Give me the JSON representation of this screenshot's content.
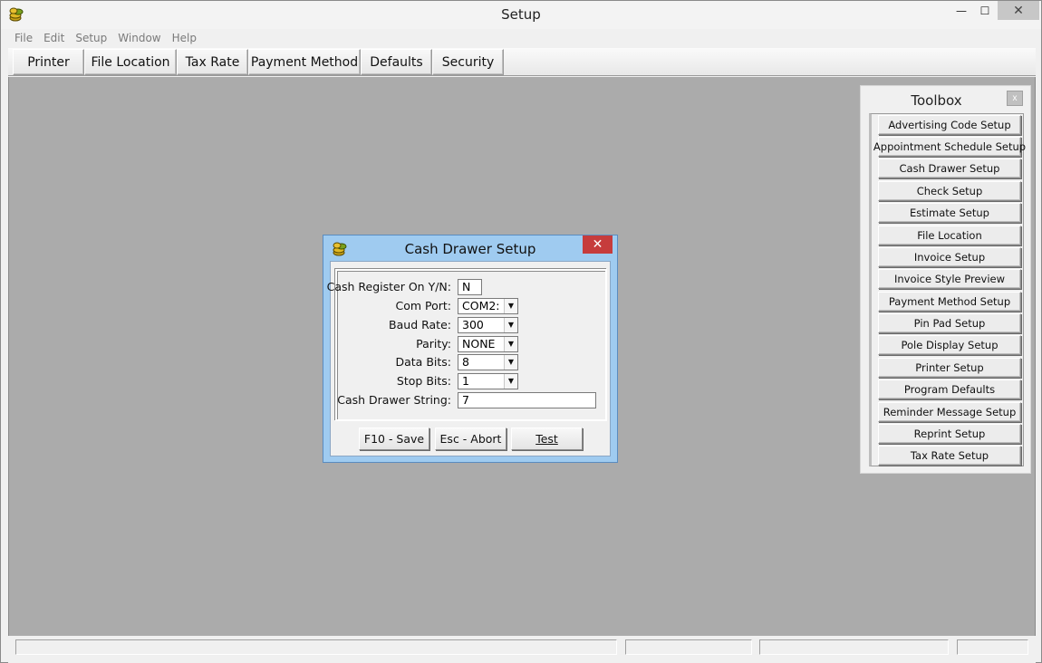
{
  "window": {
    "title": "Setup",
    "minimize_glyph": "—",
    "maximize_glyph": "☐",
    "close_glyph": "✕"
  },
  "menu": [
    "File",
    "Edit",
    "Setup",
    "Window",
    "Help"
  ],
  "toolbar": [
    "Printer",
    "File Location",
    "Tax Rate",
    "Payment Method",
    "Defaults",
    "Security"
  ],
  "toolbox": {
    "title": "Toolbox",
    "close_glyph": "x",
    "items": [
      "Advertising Code Setup",
      "Appointment Schedule Setup",
      "Cash Drawer Setup",
      "Check Setup",
      "Estimate Setup",
      "File Location",
      "Invoice Setup",
      "Invoice Style Preview",
      "Payment Method Setup",
      "Pin Pad Setup",
      "Pole Display Setup",
      "Printer Setup",
      "Program Defaults",
      "Reminder Message Setup",
      "Reprint Setup",
      "Tax Rate Setup"
    ]
  },
  "dialog": {
    "title": "Cash Drawer Setup",
    "close_glyph": "✕",
    "fields": {
      "cash_register_label": "Cash Register On Y/N:",
      "cash_register_value": "N",
      "com_port_label": "Com Port:",
      "com_port_value": "COM2:",
      "baud_rate_label": "Baud Rate:",
      "baud_rate_value": "300",
      "parity_label": "Parity:",
      "parity_value": "NONE",
      "data_bits_label": "Data Bits:",
      "data_bits_value": "8",
      "stop_bits_label": "Stop Bits:",
      "stop_bits_value": "1",
      "drawer_string_label": "Cash Drawer String:",
      "drawer_string_value": "7"
    },
    "buttons": {
      "save": "F10 - Save",
      "abort": "Esc - Abort",
      "test": "Test"
    }
  },
  "colors": {
    "workspace": "#ababab",
    "dialog_frame": "#9fcbf0",
    "dialog_close": "#c63c3c"
  },
  "icons": {
    "app": "coins-icon",
    "dropdown": "chevron-down-icon"
  }
}
